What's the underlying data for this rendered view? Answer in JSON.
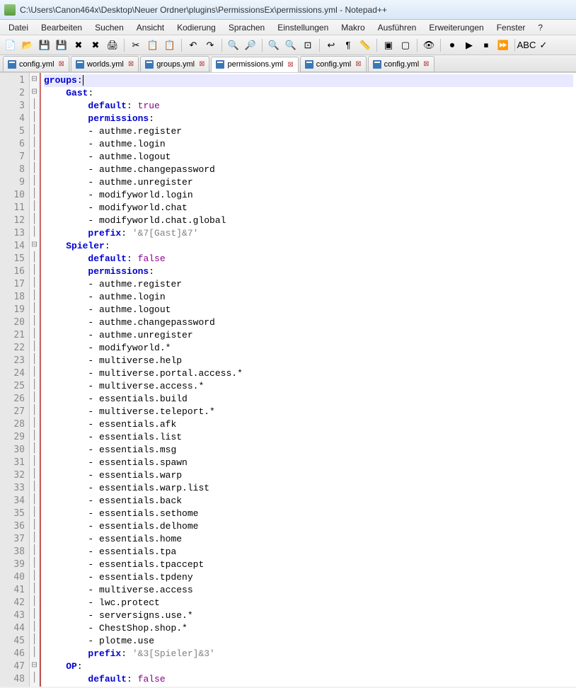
{
  "title": "C:\\Users\\Canon464x\\Desktop\\Neuer Ordner\\plugins\\PermissionsEx\\permissions.yml - Notepad++",
  "menus": [
    "Datei",
    "Bearbeiten",
    "Suchen",
    "Ansicht",
    "Kodierung",
    "Sprachen",
    "Einstellungen",
    "Makro",
    "Ausführen",
    "Erweiterungen",
    "Fenster",
    "?"
  ],
  "toolbar_icons": [
    "new-file",
    "open-file",
    "save",
    "save-all",
    "close",
    "close-all",
    "print",
    "|",
    "cut",
    "copy",
    "paste",
    "|",
    "undo",
    "redo",
    "|",
    "find",
    "replace",
    "|",
    "zoom-in",
    "zoom-out",
    "fit",
    "|",
    "wrap",
    "show-all",
    "indent-guide",
    "|",
    "fold-all",
    "unfold-all",
    "|",
    "hidden-chars",
    "|",
    "macro-record",
    "macro-play",
    "macro-stop",
    "macro-fast",
    "|",
    "spell-check",
    "spell-lang"
  ],
  "tabs": [
    {
      "label": "config.yml",
      "active": false
    },
    {
      "label": "worlds.yml",
      "active": false
    },
    {
      "label": "groups.yml",
      "active": false
    },
    {
      "label": "permissions.yml",
      "active": true
    },
    {
      "label": "config.yml",
      "active": false
    },
    {
      "label": "config.yml",
      "active": false
    }
  ],
  "code_lines": [
    {
      "n": 1,
      "fold": "-",
      "indent": 0,
      "type": "key",
      "key": "groups",
      "val": "",
      "current": true
    },
    {
      "n": 2,
      "fold": "-",
      "indent": 1,
      "type": "key",
      "key": "Gast",
      "val": ""
    },
    {
      "n": 3,
      "fold": "",
      "indent": 2,
      "type": "kv",
      "key": "default",
      "val": "true"
    },
    {
      "n": 4,
      "fold": "",
      "indent": 2,
      "type": "keycolon",
      "key": "permissions",
      "val": ""
    },
    {
      "n": 5,
      "fold": "",
      "indent": 2,
      "type": "item",
      "item": "authme.register"
    },
    {
      "n": 6,
      "fold": "",
      "indent": 2,
      "type": "item",
      "item": "authme.login"
    },
    {
      "n": 7,
      "fold": "",
      "indent": 2,
      "type": "item",
      "item": "authme.logout"
    },
    {
      "n": 8,
      "fold": "",
      "indent": 2,
      "type": "item",
      "item": "authme.changepassword"
    },
    {
      "n": 9,
      "fold": "",
      "indent": 2,
      "type": "item",
      "item": "authme.unregister"
    },
    {
      "n": 10,
      "fold": "",
      "indent": 2,
      "type": "item",
      "item": "modifyworld.login"
    },
    {
      "n": 11,
      "fold": "",
      "indent": 2,
      "type": "item",
      "item": "modifyworld.chat"
    },
    {
      "n": 12,
      "fold": "",
      "indent": 2,
      "type": "item",
      "item": "modifyworld.chat.global"
    },
    {
      "n": 13,
      "fold": "",
      "indent": 2,
      "type": "kvstr",
      "key": "prefix",
      "val": "'&7[Gast]&7'"
    },
    {
      "n": 14,
      "fold": "-",
      "indent": 1,
      "type": "key",
      "key": "Spieler",
      "val": ""
    },
    {
      "n": 15,
      "fold": "",
      "indent": 2,
      "type": "kv",
      "key": "default",
      "val": "false"
    },
    {
      "n": 16,
      "fold": "",
      "indent": 2,
      "type": "keycolon",
      "key": "permissions",
      "val": ""
    },
    {
      "n": 17,
      "fold": "",
      "indent": 2,
      "type": "item",
      "item": "authme.register"
    },
    {
      "n": 18,
      "fold": "",
      "indent": 2,
      "type": "item",
      "item": "authme.login"
    },
    {
      "n": 19,
      "fold": "",
      "indent": 2,
      "type": "item",
      "item": "authme.logout"
    },
    {
      "n": 20,
      "fold": "",
      "indent": 2,
      "type": "item",
      "item": "authme.changepassword"
    },
    {
      "n": 21,
      "fold": "",
      "indent": 2,
      "type": "item",
      "item": "authme.unregister"
    },
    {
      "n": 22,
      "fold": "",
      "indent": 2,
      "type": "item",
      "item": "modifyworld.*"
    },
    {
      "n": 23,
      "fold": "",
      "indent": 2,
      "type": "item",
      "item": "multiverse.help"
    },
    {
      "n": 24,
      "fold": "",
      "indent": 2,
      "type": "item",
      "item": "multiverse.portal.access.*"
    },
    {
      "n": 25,
      "fold": "",
      "indent": 2,
      "type": "item",
      "item": "multiverse.access.*"
    },
    {
      "n": 26,
      "fold": "",
      "indent": 2,
      "type": "item",
      "item": "essentials.build"
    },
    {
      "n": 27,
      "fold": "",
      "indent": 2,
      "type": "item",
      "item": "multiverse.teleport.*"
    },
    {
      "n": 28,
      "fold": "",
      "indent": 2,
      "type": "item",
      "item": "essentials.afk"
    },
    {
      "n": 29,
      "fold": "",
      "indent": 2,
      "type": "item",
      "item": "essentials.list"
    },
    {
      "n": 30,
      "fold": "",
      "indent": 2,
      "type": "item",
      "item": "essentials.msg"
    },
    {
      "n": 31,
      "fold": "",
      "indent": 2,
      "type": "item",
      "item": "essentials.spawn"
    },
    {
      "n": 32,
      "fold": "",
      "indent": 2,
      "type": "item",
      "item": "essentials.warp"
    },
    {
      "n": 33,
      "fold": "",
      "indent": 2,
      "type": "item",
      "item": "essentials.warp.list"
    },
    {
      "n": 34,
      "fold": "",
      "indent": 2,
      "type": "item",
      "item": "essentials.back"
    },
    {
      "n": 35,
      "fold": "",
      "indent": 2,
      "type": "item",
      "item": "essentials.sethome"
    },
    {
      "n": 36,
      "fold": "",
      "indent": 2,
      "type": "item",
      "item": "essentials.delhome"
    },
    {
      "n": 37,
      "fold": "",
      "indent": 2,
      "type": "item",
      "item": "essentials.home"
    },
    {
      "n": 38,
      "fold": "",
      "indent": 2,
      "type": "item",
      "item": "essentials.tpa"
    },
    {
      "n": 39,
      "fold": "",
      "indent": 2,
      "type": "item",
      "item": "essentials.tpaccept"
    },
    {
      "n": 40,
      "fold": "",
      "indent": 2,
      "type": "item",
      "item": "essentials.tpdeny"
    },
    {
      "n": 41,
      "fold": "",
      "indent": 2,
      "type": "item",
      "item": "multiverse.access"
    },
    {
      "n": 42,
      "fold": "",
      "indent": 2,
      "type": "item",
      "item": "lwc.protect"
    },
    {
      "n": 43,
      "fold": "",
      "indent": 2,
      "type": "item",
      "item": "serversigns.use.*"
    },
    {
      "n": 44,
      "fold": "",
      "indent": 2,
      "type": "item",
      "item": "ChestShop.shop.*"
    },
    {
      "n": 45,
      "fold": "",
      "indent": 2,
      "type": "item",
      "item": "plotme.use"
    },
    {
      "n": 46,
      "fold": "",
      "indent": 2,
      "type": "kvstr",
      "key": "prefix",
      "val": "'&3[Spieler]&3'"
    },
    {
      "n": 47,
      "fold": "-",
      "indent": 1,
      "type": "key",
      "key": "OP",
      "val": ""
    },
    {
      "n": 48,
      "fold": "",
      "indent": 2,
      "type": "kv",
      "key": "default",
      "val": "false"
    }
  ],
  "icon_glyphs": {
    "new-file": "📄",
    "open-file": "📂",
    "save": "💾",
    "save-all": "💾",
    "close": "✖",
    "close-all": "✖",
    "print": "🖨",
    "cut": "✂",
    "copy": "📋",
    "paste": "📋",
    "undo": "↶",
    "redo": "↷",
    "find": "🔍",
    "replace": "🔎",
    "zoom-in": "🔍",
    "zoom-out": "🔍",
    "fit": "⊡",
    "wrap": "↩",
    "show-all": "¶",
    "indent-guide": "📏",
    "fold-all": "▣",
    "unfold-all": "▢",
    "hidden-chars": "👁",
    "macro-record": "⏺",
    "macro-play": "▶",
    "macro-stop": "⏹",
    "macro-fast": "⏩",
    "spell-check": "ABC",
    "spell-lang": "✓"
  }
}
